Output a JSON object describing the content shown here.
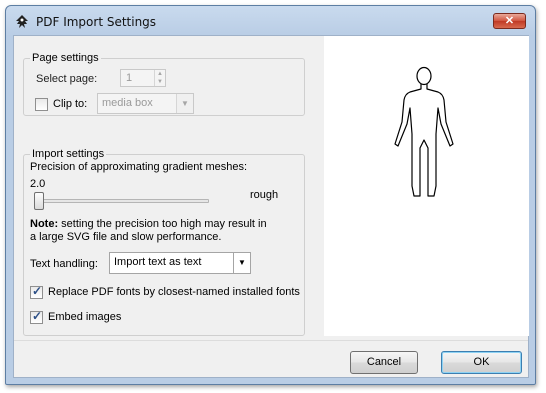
{
  "window": {
    "title": "PDF Import Settings",
    "close_label": "✕"
  },
  "page_settings": {
    "legend": "Page settings",
    "select_page_label": "Select page:",
    "select_page_value": "1",
    "clip_to_label": "Clip to:",
    "clip_to_checked": false,
    "clip_to_value": "media box"
  },
  "import_settings": {
    "legend": "Import settings",
    "precision_label": "Precision of approximating gradient meshes:",
    "precision_value": "2.0",
    "precision_slider": 0.0,
    "precision_desc": "rough",
    "note_bold": "Note:",
    "note_line1": " setting the precision too high may result in",
    "note_line2": "a large SVG file and slow performance.",
    "text_handling_label": "Text handling:",
    "text_handling_value": "Import text as text",
    "replace_fonts_label": "Replace PDF fonts by closest-named installed fonts",
    "replace_fonts_checked": true,
    "embed_images_label": "Embed images",
    "embed_images_checked": true
  },
  "buttons": {
    "cancel": "Cancel",
    "ok": "OK"
  }
}
